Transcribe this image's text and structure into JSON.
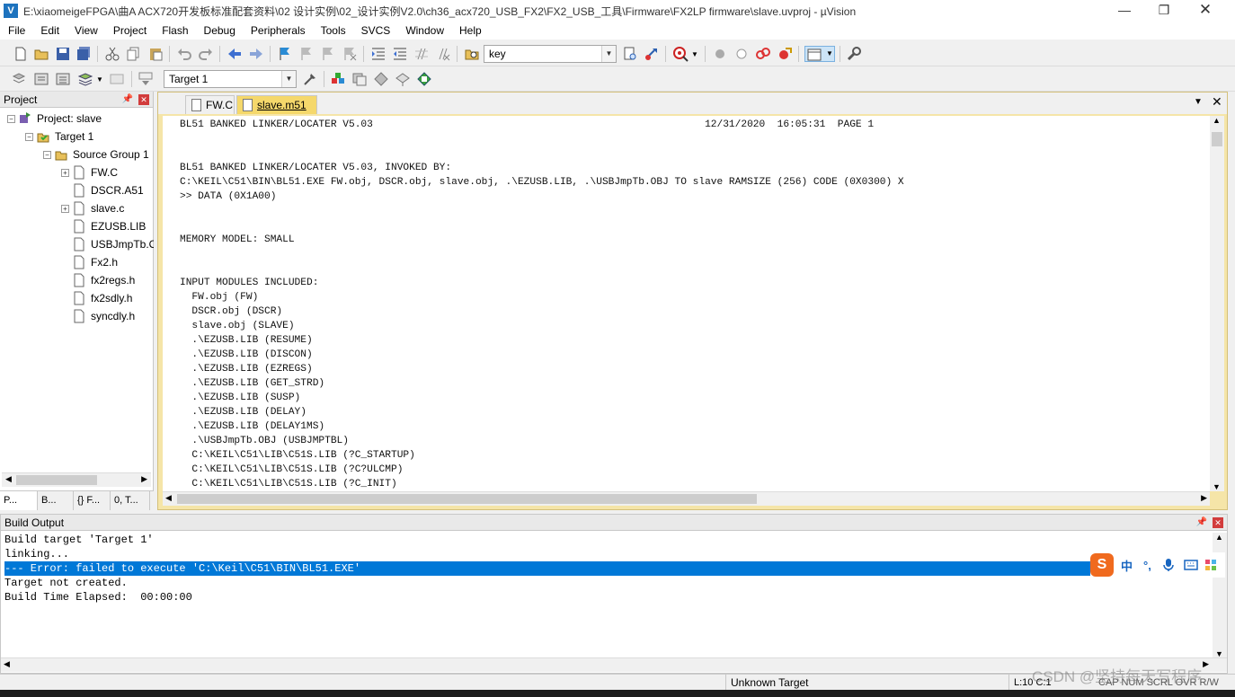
{
  "window": {
    "title": "E:\\xiaomeigeFPGA\\曲A ACX720开发板标准配套资料\\02 设计实例\\02_设计实例V2.0\\ch36_acx720_USB_FX2\\FX2_USB_工具\\Firmware\\FX2LP firmware\\slave.uvproj - µVision",
    "app_icon": "V"
  },
  "menu": [
    "File",
    "Edit",
    "View",
    "Project",
    "Flash",
    "Debug",
    "Peripherals",
    "Tools",
    "SVCS",
    "Window",
    "Help"
  ],
  "toolbar": {
    "find_value": "key",
    "target_value": "Target 1"
  },
  "project_panel": {
    "title": "Project",
    "tree": {
      "project": "Project: slave",
      "target": "Target 1",
      "group": "Source Group 1",
      "files": [
        "FW.C",
        "DSCR.A51",
        "slave.c",
        "EZUSB.LIB",
        "USBJmpTb.OBJ",
        "Fx2.h",
        "fx2regs.h",
        "fx2sdly.h",
        "syncdly.h"
      ]
    },
    "tabs": [
      "P...",
      "B...",
      "{} F...",
      "0, T..."
    ]
  },
  "editor": {
    "tabs": [
      {
        "label": "FW.C",
        "active": false
      },
      {
        "label": "slave.m51",
        "active": true
      }
    ],
    "lines": [
      "BL51 BANKED LINKER/LOCATER V5.03                                                       12/31/2020  16:05:31  PAGE 1",
      "",
      "",
      "BL51 BANKED LINKER/LOCATER V5.03, INVOKED BY:",
      "C:\\KEIL\\C51\\BIN\\BL51.EXE FW.obj, DSCR.obj, slave.obj, .\\EZUSB.LIB, .\\USBJmpTb.OBJ TO slave RAMSIZE (256) CODE (0X0300) X",
      ">> DATA (0X1A00)",
      "",
      "",
      "MEMORY MODEL: SMALL",
      "",
      "",
      "INPUT MODULES INCLUDED:",
      "  FW.obj (FW)",
      "  DSCR.obj (DSCR)",
      "  slave.obj (SLAVE)",
      "  .\\EZUSB.LIB (RESUME)",
      "  .\\EZUSB.LIB (DISCON)",
      "  .\\EZUSB.LIB (EZREGS)",
      "  .\\EZUSB.LIB (GET_STRD)",
      "  .\\EZUSB.LIB (SUSP)",
      "  .\\EZUSB.LIB (DELAY)",
      "  .\\EZUSB.LIB (DELAY1MS)",
      "  .\\USBJmpTb.OBJ (USBJMPTBL)",
      "  C:\\KEIL\\C51\\LIB\\C51S.LIB (?C_STARTUP)",
      "  C:\\KEIL\\C51\\LIB\\C51S.LIB (?C?ULCMP)",
      "  C:\\KEIL\\C51\\LIB\\C51S.LIB (?C_INIT)"
    ]
  },
  "build_output": {
    "title": "Build Output",
    "lines": [
      {
        "text": "Build target 'Target 1'",
        "error": false
      },
      {
        "text": "linking...",
        "error": false
      },
      {
        "text": "--- Error: failed to execute 'C:\\Keil\\C51\\BIN\\BL51.EXE'",
        "error": true
      },
      {
        "text": "Target not created.",
        "error": false
      },
      {
        "text": "Build Time Elapsed:  00:00:00",
        "error": false
      }
    ]
  },
  "status": {
    "target": "Unknown Target",
    "position": "L:10 C:1",
    "flags": "CAP  NUM  SCRL  OVR  R/W",
    "watermark": "CSDN @坚持每天写程序"
  },
  "ime": {
    "logo": "S",
    "items": [
      "中",
      "°,"
    ]
  },
  "colors": {
    "editor_frame": "#f5e5a8",
    "selection": "#0078d7",
    "close_button": "#d23c3c"
  }
}
